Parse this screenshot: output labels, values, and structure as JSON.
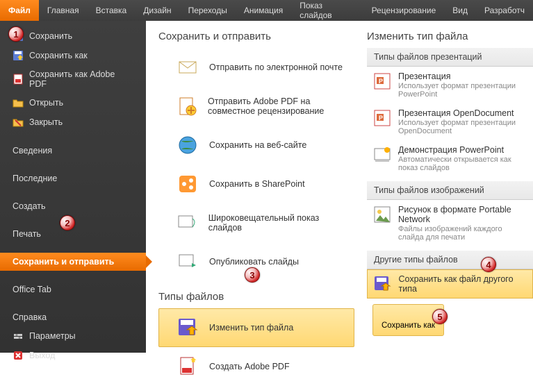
{
  "ribbon": {
    "tabs": [
      {
        "label": "Файл",
        "active": true
      },
      {
        "label": "Главная"
      },
      {
        "label": "Вставка"
      },
      {
        "label": "Дизайн"
      },
      {
        "label": "Переходы"
      },
      {
        "label": "Анимация"
      },
      {
        "label": "Показ слайдов"
      },
      {
        "label": "Рецензирование"
      },
      {
        "label": "Вид"
      },
      {
        "label": "Разработч"
      }
    ]
  },
  "sidebar": {
    "items": [
      {
        "label": "Сохранить",
        "icon": "save"
      },
      {
        "label": "Сохранить как",
        "icon": "saveas"
      },
      {
        "label": "Сохранить как Adobe PDF",
        "icon": "pdf"
      },
      {
        "label": "Открыть",
        "icon": "open"
      },
      {
        "label": "Закрыть",
        "icon": "close"
      },
      {
        "label": "Сведения",
        "section": true
      },
      {
        "label": "Последние",
        "section": true
      },
      {
        "label": "Создать",
        "section": true
      },
      {
        "label": "Печать",
        "section": true
      },
      {
        "label": "Сохранить и отправить",
        "section": true,
        "selected": true
      },
      {
        "label": "Office Tab",
        "section": true
      },
      {
        "label": "Справка",
        "section": true
      },
      {
        "label": "Параметры",
        "icon": "options"
      },
      {
        "label": "Выход",
        "icon": "exit"
      }
    ]
  },
  "left_col": {
    "title1": "Сохранить и отправить",
    "actions": [
      {
        "label": "Отправить по электронной почте",
        "icon": "mail"
      },
      {
        "label": "Отправить Adobe PDF на совместное рецензирование",
        "icon": "pdfreview"
      },
      {
        "label": "Сохранить на веб-сайте",
        "icon": "globe"
      },
      {
        "label": "Сохранить в SharePoint",
        "icon": "sharepoint"
      },
      {
        "label": "Широковещательный показ слайдов",
        "icon": "broadcast"
      },
      {
        "label": "Опубликовать слайды",
        "icon": "publish"
      }
    ],
    "title2": "Типы файлов",
    "actions2": [
      {
        "label": "Изменить тип файла",
        "icon": "changetype",
        "highlight": true
      },
      {
        "label": "Создать Adobe PDF",
        "icon": "pdfcreate"
      }
    ]
  },
  "right_col": {
    "title": "Изменить тип файла",
    "group1_header": "Типы файлов презентаций",
    "group1": [
      {
        "label": "Презентация",
        "desc": "Использует формат презентации PowerPoint"
      },
      {
        "label": "Презентация OpenDocument",
        "desc": "Использует формат презентации OpenDocument"
      },
      {
        "label": "Демонстрация PowerPoint",
        "desc": "Автоматически открывается как показ слайдов"
      }
    ],
    "group2_header": "Типы файлов изображений",
    "group2": [
      {
        "label": "Рисунок в формате Portable Network",
        "desc": "Файлы изображений каждого слайда для печати"
      }
    ],
    "group3_header": "Другие типы файлов",
    "group3": [
      {
        "label": "Сохранить как файл другого типа",
        "highlight": true
      }
    ],
    "saveas_label": "Сохранить как"
  },
  "badges": {
    "b1": "1",
    "b2": "2",
    "b3": "3",
    "b4": "4",
    "b5": "5"
  }
}
